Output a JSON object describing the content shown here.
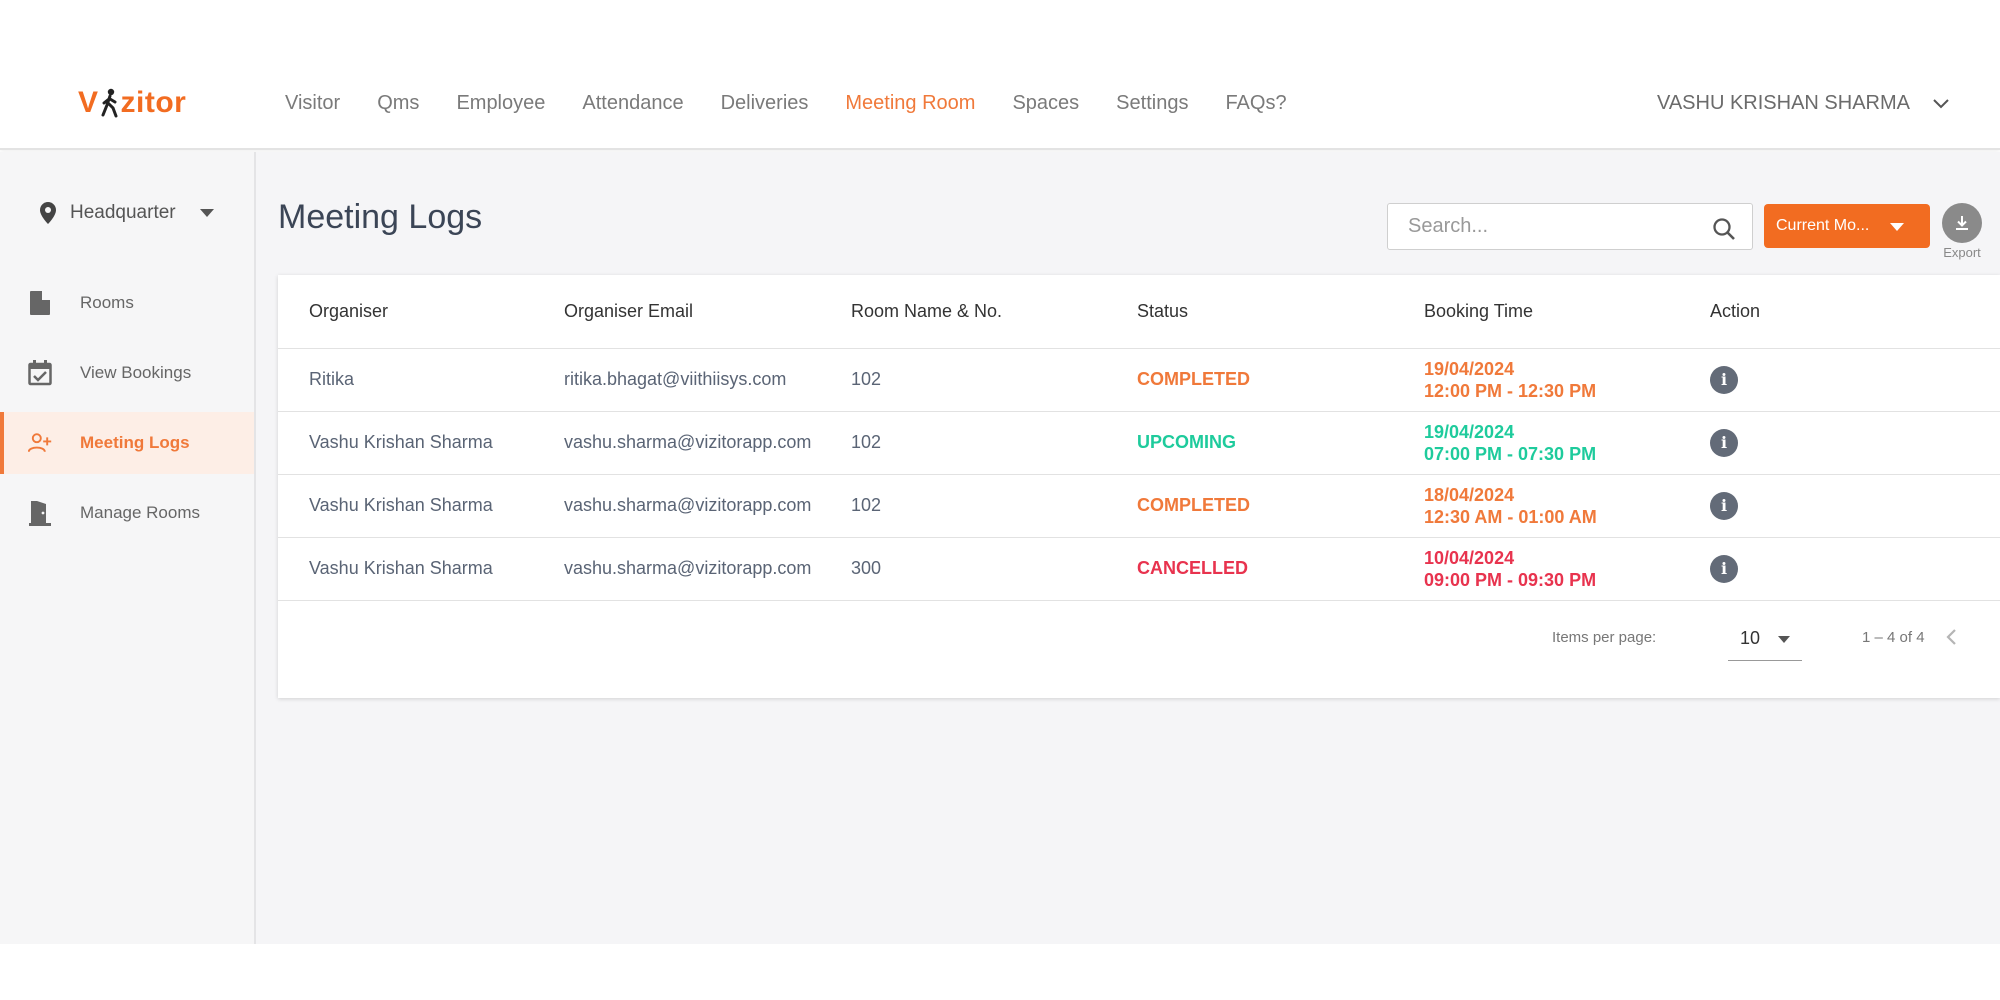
{
  "brand": {
    "logo_text_prefix": "V",
    "logo_text_suffix": "zitor",
    "accent": "#f26c21"
  },
  "nav": {
    "items": [
      {
        "label": "Visitor",
        "active": false
      },
      {
        "label": "Qms",
        "active": false
      },
      {
        "label": "Employee",
        "active": false
      },
      {
        "label": "Attendance",
        "active": false
      },
      {
        "label": "Deliveries",
        "active": false
      },
      {
        "label": "Meeting Room",
        "active": true
      },
      {
        "label": "Spaces",
        "active": false
      },
      {
        "label": "Settings",
        "active": false
      },
      {
        "label": "FAQs?",
        "active": false
      }
    ],
    "user_name": "VASHU KRISHAN SHARMA"
  },
  "sidebar": {
    "location": "Headquarter",
    "items": [
      {
        "label": "Rooms",
        "icon": "door-icon",
        "active": false
      },
      {
        "label": "View Bookings",
        "icon": "calendar-check-icon",
        "active": false
      },
      {
        "label": "Meeting Logs",
        "icon": "add-user-icon",
        "active": true
      },
      {
        "label": "Manage Rooms",
        "icon": "door-open-icon",
        "active": false
      }
    ]
  },
  "main": {
    "title": "Meeting Logs",
    "search_placeholder": "Search...",
    "period_label": "Current Mo...",
    "export_label": "Export"
  },
  "table": {
    "headers": [
      "Organiser",
      "Organiser Email",
      "Room Name & No.",
      "Status",
      "Booking Time",
      "Action"
    ],
    "rows": [
      {
        "organiser": "Ritika",
        "email": "ritika.bhagat@viithiisys.com",
        "room": "102",
        "status": "COMPLETED",
        "date": "19/04/2024",
        "time": "12:00 PM - 12:30 PM"
      },
      {
        "organiser": "Vashu Krishan Sharma",
        "email": "vashu.sharma@vizitorapp.com",
        "room": "102",
        "status": "UPCOMING",
        "date": "19/04/2024",
        "time": "07:00 PM - 07:30 PM"
      },
      {
        "organiser": "Vashu Krishan Sharma",
        "email": "vashu.sharma@vizitorapp.com",
        "room": "102",
        "status": "COMPLETED",
        "date": "18/04/2024",
        "time": "12:30 AM - 01:00 AM"
      },
      {
        "organiser": "Vashu Krishan Sharma",
        "email": "vashu.sharma@vizitorapp.com",
        "room": "300",
        "status": "CANCELLED",
        "date": "10/04/2024",
        "time": "09:00 PM - 09:30 PM"
      }
    ],
    "status_colors": {
      "COMPLETED": "#f0793a",
      "UPCOMING": "#1ecb9c",
      "CANCELLED": "#e8334e"
    }
  },
  "pagination": {
    "items_per_page_label": "Items per page:",
    "items_per_page": "10",
    "range": "1 – 4 of 4"
  }
}
